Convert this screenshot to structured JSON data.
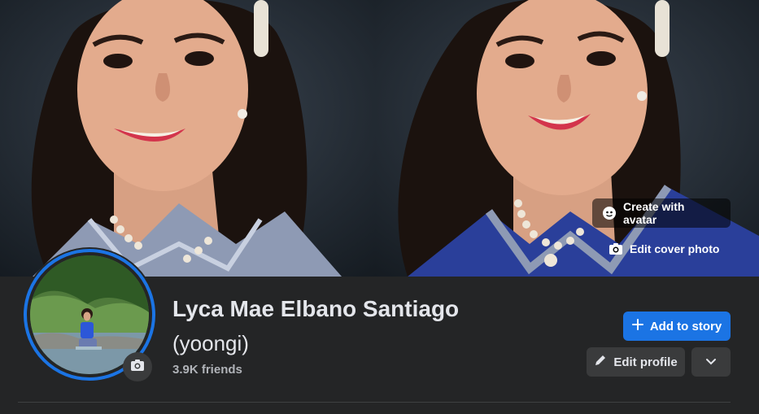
{
  "cover": {
    "create_avatar_label": "Create with avatar",
    "edit_cover_label": "Edit cover photo"
  },
  "profile": {
    "name": "Lyca Mae Elbano Santiago",
    "alternate_name": "(yoongi)",
    "friends_count": "3.9K friends"
  },
  "actions": {
    "add_story_label": "Add to story",
    "edit_profile_label": "Edit profile"
  },
  "icons": {
    "avatar": "avatar-face-icon",
    "camera": "camera-icon",
    "plus": "plus-icon",
    "pencil": "pencil-icon",
    "chevron": "chevron-down-icon"
  },
  "colors": {
    "accent": "#1b74e4",
    "background": "#242526",
    "secondary_button": "#3a3b3c",
    "muted_text": "#b0b3b8"
  }
}
